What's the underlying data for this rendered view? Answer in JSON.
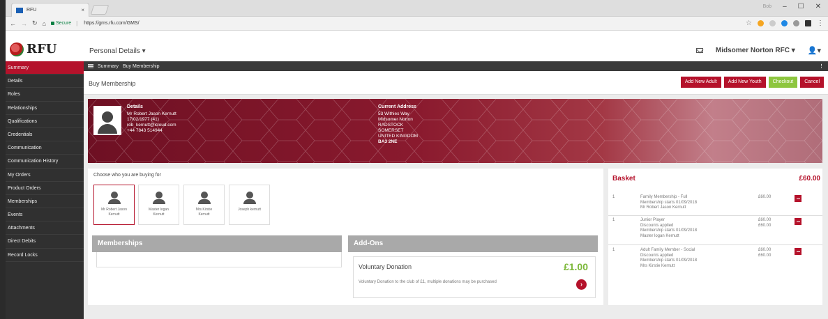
{
  "browser": {
    "tab_title": "RFU",
    "tab_favicon": "rfu-favicon-icon",
    "secure_label": "Secure",
    "url": "https://gms.rfu.com/GMS/",
    "window_user": "Bob"
  },
  "header": {
    "logo_text": "RFU",
    "title": "Personal Details",
    "club": "Midsomer Norton RFC"
  },
  "sidebar": {
    "items": [
      {
        "label": "Summary",
        "active": true
      },
      {
        "label": "Details"
      },
      {
        "label": "Roles"
      },
      {
        "label": "Relationships"
      },
      {
        "label": "Qualifications"
      },
      {
        "label": "Credentials"
      },
      {
        "label": "Communication"
      },
      {
        "label": "Communication History"
      },
      {
        "label": "My Orders"
      },
      {
        "label": "Product Orders"
      },
      {
        "label": "Memberships"
      },
      {
        "label": "Events"
      },
      {
        "label": "Attachments"
      },
      {
        "label": "Direct Debits"
      },
      {
        "label": "Record Locks"
      }
    ]
  },
  "breadcrumb": {
    "items": [
      "Summary",
      "Buy Membership"
    ]
  },
  "page": {
    "title": "Buy Membership",
    "buttons": {
      "add_adult": "Add New Adult",
      "add_youth": "Add New Youth",
      "checkout": "Checkout",
      "cancel": "Cancel"
    }
  },
  "profile": {
    "details_heading": "Details",
    "name": "Mr Robert Jason Kernutt",
    "dob": "17/02/1977 (41)",
    "email": "rob_kernutt@icloud.com",
    "phone": "+44 7843 514944",
    "address_heading": "Current Address",
    "address_lines": [
      "53 Withies Way",
      "Midsomer Norton",
      "RADSTOCK",
      "SOMERSET",
      "UNITED KINGDOM"
    ],
    "postcode": "BA3 2NE"
  },
  "choose": {
    "title": "Choose who you are buying for",
    "people": [
      {
        "name_line1": "Mr Robert Jason",
        "name_line2": "Kernutt",
        "selected": true
      },
      {
        "name_line1": "Master logan",
        "name_line2": "Kernutt"
      },
      {
        "name_line1": "Mrs Kirstie",
        "name_line2": "Kernutt"
      },
      {
        "name_line1": "Joseph kernutt",
        "name_line2": ""
      }
    ]
  },
  "memberships": {
    "heading": "Memberships"
  },
  "addons": {
    "heading": "Add-Ons",
    "item": {
      "title": "Voluntary Donation",
      "price": "£1.00",
      "description": "Voluntary Donation to the club of £1, multiple donations may be purchased"
    }
  },
  "basket": {
    "title": "Basket",
    "total": "£60.00",
    "rows": [
      {
        "qty": "1",
        "lines": [
          "Family Membership - Full",
          "Membership starts 01/09/2018",
          "Mr Robert Jason Kernutt"
        ],
        "prices": [
          "£60.00"
        ]
      },
      {
        "qty": "1",
        "lines": [
          "Junior Player",
          "Discounts applied",
          "Membership starts 01/09/2018",
          "Master logan Kernutt"
        ],
        "prices": [
          "£60.00",
          "£60.00"
        ]
      },
      {
        "qty": "1",
        "lines": [
          "Adult Family Member - Social",
          "Discounts applied",
          "Membership starts 01/09/2018",
          "Mrs Kirstie Kernutt"
        ],
        "prices": [
          "£60.00",
          "£60.00"
        ]
      }
    ]
  },
  "colors": {
    "brand_red": "#b5122b",
    "checkout_green": "#8dc63f",
    "sidebar_bg": "#303030"
  }
}
